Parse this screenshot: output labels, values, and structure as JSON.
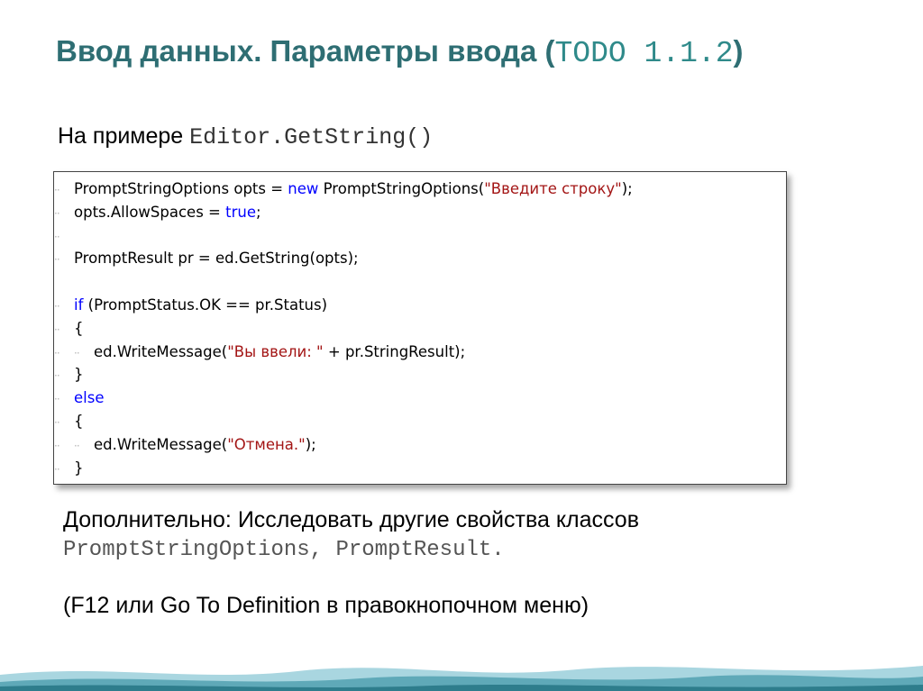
{
  "title": {
    "text": "Ввод данных. Параметры ввода (",
    "code": "TODO 1.1.2",
    "close": ")"
  },
  "subtitle": {
    "text": "На примере ",
    "code": "Editor.GetString()"
  },
  "code_lines": [
    {
      "indent": "··",
      "parts": [
        [
          "plain",
          "PromptStringOptions opts = "
        ],
        [
          "kw",
          "new"
        ],
        [
          "plain",
          " PromptStringOptions("
        ],
        [
          "str",
          "\"Введите строку\""
        ],
        [
          "plain",
          ");"
        ]
      ]
    },
    {
      "indent": "··",
      "parts": [
        [
          "plain",
          "opts.AllowSpaces = "
        ],
        [
          "kw",
          "true"
        ],
        [
          "plain",
          ";"
        ]
      ]
    },
    {
      "indent": "··",
      "parts": []
    },
    {
      "indent": "··",
      "parts": [
        [
          "plain",
          "PromptResult pr = ed.GetString(opts);"
        ]
      ]
    },
    {
      "indent": "",
      "parts": []
    },
    {
      "indent": "··",
      "parts": [
        [
          "kw",
          "if"
        ],
        [
          "plain",
          " (PromptStatus.OK == pr.Status)"
        ]
      ]
    },
    {
      "indent": "··",
      "parts": [
        [
          "plain",
          "{"
        ]
      ]
    },
    {
      "indent": "····",
      "parts": [
        [
          "plain",
          "ed.WriteMessage("
        ],
        [
          "str",
          "\"Вы ввели: \""
        ],
        [
          "plain",
          " + pr.StringResult);"
        ]
      ]
    },
    {
      "indent": "··",
      "parts": [
        [
          "plain",
          "}"
        ]
      ]
    },
    {
      "indent": "··",
      "parts": [
        [
          "kw",
          "else"
        ]
      ]
    },
    {
      "indent": "··",
      "parts": [
        [
          "plain",
          "{"
        ]
      ]
    },
    {
      "indent": "····",
      "parts": [
        [
          "plain",
          "ed.WriteMessage("
        ],
        [
          "str",
          "\"Отмена.\""
        ],
        [
          "plain",
          ");"
        ]
      ]
    },
    {
      "indent": "··",
      "parts": [
        [
          "plain",
          "}"
        ]
      ]
    }
  ],
  "extra": {
    "text": "Дополнительно: Исследовать другие свойства  классов",
    "code": "PromptStringOptions, PromptResult."
  },
  "note": "(F12 или Go To Definition в правокнопочном меню)",
  "colors": {
    "title": "#2e6e73",
    "keyword": "#0000ff",
    "string": "#a31515",
    "wave_light": "#a9d6e0",
    "wave_dark": "#2e7d8c"
  }
}
